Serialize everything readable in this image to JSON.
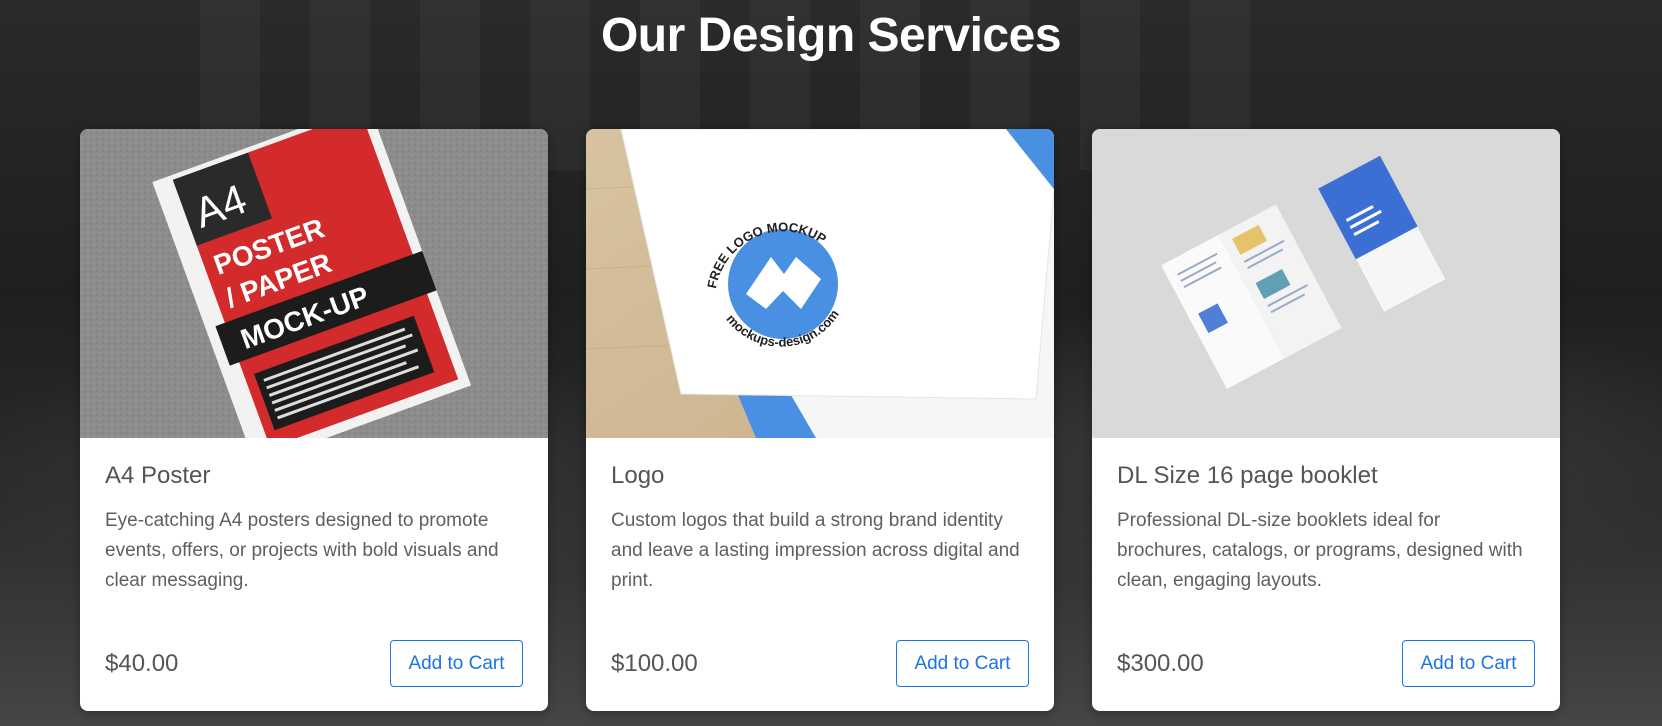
{
  "page": {
    "heading": "Our Design Services"
  },
  "services": [
    {
      "title": "A4 Poster",
      "description": "Eye-catching A4 posters designed to promote events, offers, or projects with bold visuals and clear messaging.",
      "price": "$40.00",
      "button_label": "Add to Cart",
      "image": {
        "big": "A4",
        "line1": "POSTER",
        "line2": "/ PAPER",
        "line3": "MOCK-UP"
      }
    },
    {
      "title": "Logo",
      "description": "Custom logos that build a strong brand identity and leave a lasting impression across digital and print.",
      "price": "$100.00",
      "button_label": "Add to Cart",
      "image": {
        "top_text": "FREE LOGO MOCKUP",
        "bottom_text": "mockups-design.com"
      }
    },
    {
      "title": "DL Size 16 page booklet",
      "description": "Professional DL-size booklets ideal for brochures, catalogs, or programs, designed with clean, engaging layouts.",
      "price": "$300.00",
      "button_label": "Add to Cart",
      "image": {}
    }
  ],
  "colors": {
    "accent": "#1a73e8",
    "poster_red": "#d32b2b",
    "logo_blue": "#4a90e2",
    "booklet_blue": "#3b6fd4"
  }
}
